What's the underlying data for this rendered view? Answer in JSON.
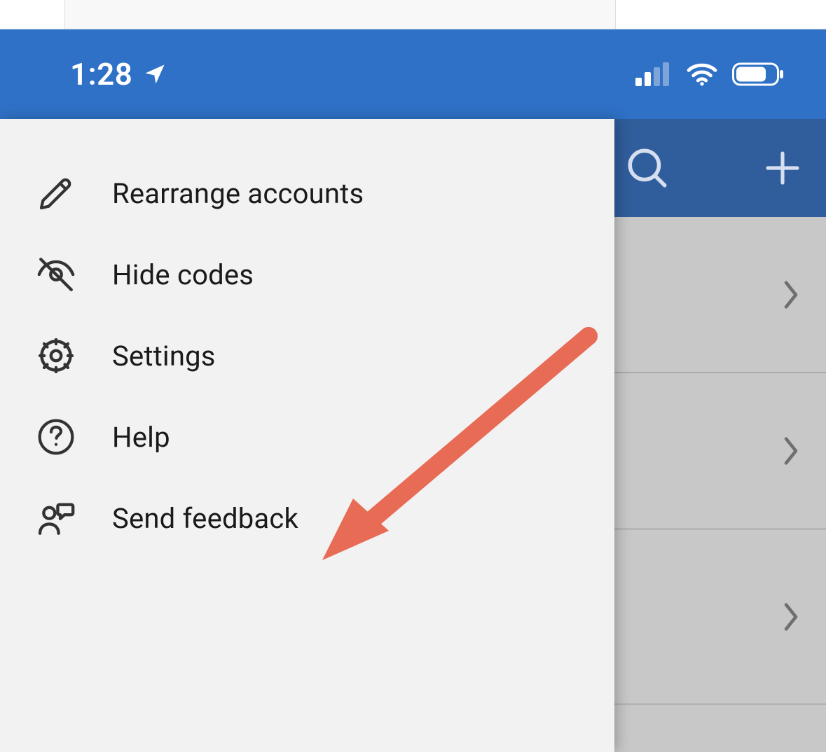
{
  "statusBar": {
    "time": "1:28"
  },
  "menu": {
    "items": [
      {
        "label": "Rearrange accounts",
        "icon": "pencil-icon"
      },
      {
        "label": "Hide codes",
        "icon": "eye-off-icon"
      },
      {
        "label": "Settings",
        "icon": "gear-icon"
      },
      {
        "label": "Help",
        "icon": "question-circle-icon"
      },
      {
        "label": "Send feedback",
        "icon": "feedback-icon"
      }
    ]
  },
  "annotation": {
    "arrowColor": "#E86B56"
  },
  "colors": {
    "statusBarBg": "#2f71c6",
    "rightHeaderBg": "#305d9b",
    "menuBg": "#f2f2f2",
    "rightPaneBg": "#c8c8c8"
  }
}
